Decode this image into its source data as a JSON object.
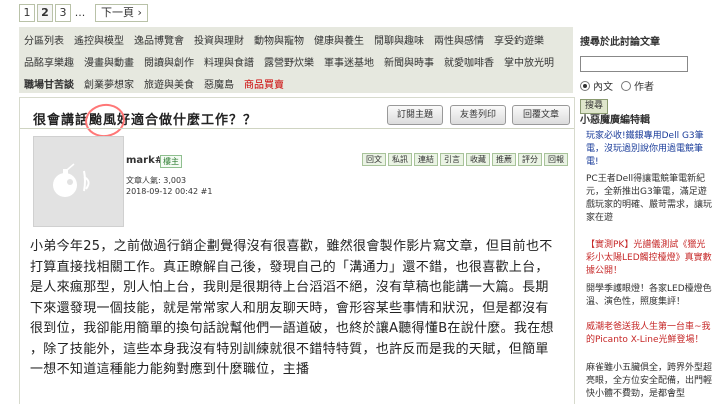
{
  "pager": {
    "pages": [
      "1",
      "2",
      "3"
    ],
    "ellipsis": "...",
    "next": "下一頁 ›"
  },
  "categories": {
    "row1": [
      "分區列表",
      "遙控與模型",
      "逸品博覽會",
      "投資與理財",
      "動物與寵物",
      "健康與養生",
      "閒聊與趣味",
      "兩性與感情",
      "享受釣遊樂"
    ],
    "row2": [
      "品酩享樂趣",
      "漫畫與動畫",
      "閱讀與創作",
      "料理與食譜",
      "露營野炊樂",
      "軍事迷基地",
      "新聞與時事",
      "就愛咖啡香",
      "掌中放光明"
    ],
    "row3": [
      "職場甘苦談",
      "創業夢想家",
      "旅遊與美食",
      "惡魔島"
    ],
    "row3_hot": "商品買賣"
  },
  "thread": {
    "title": "很會講話颱風好適合做什麼工作？？",
    "buttons": [
      "訂閱主題",
      "友善列印",
      "回覆文章"
    ]
  },
  "post": {
    "author": "mark#",
    "level": "樓主",
    "actions": [
      "回文",
      "私訊",
      "連結",
      "引言",
      "收藏",
      "推薦",
      "評分",
      "回報"
    ],
    "count_label": "文章人氣: 3,003",
    "timestamp": "2018-09-12 00:42",
    "floor": "#1",
    "body": "小弟今年25，之前做過行銷企劃覺得沒有很喜歡，雖然很會製作影片寫文章，但目前也不 打算直接找相關工作。真正瞭解自己後，發現自己的「溝通力」還不錯，也很喜歡上台，  是人來瘋那型，別人怕上台，我則是很期待上台滔滔不絕，沒有草稿也能講一大篇。長期 下來還發現一個技能，就是常常家人和朋友聊天時，會形容某些事情和狀況，但是都沒有 很到位，我卻能用簡單的換句話說幫他們一語道破，也終於讓A聽得懂B在說什麼。我在想 ，除了技能外，這些本身我沒有特別訓練就很不錯特特質，也許反而是我的天賦，但簡單 一想不知道這種能力能夠對應到什麼職位，主播"
  },
  "sidebar": {
    "search_title": "搜尋於此討論文章",
    "radio_text": "內文",
    "radio_author": "作者",
    "search_button": "搜尋",
    "section_title": "小惡魔廣編特輯",
    "items": [
      {
        "title": "玩家必收!鐵銀專用Dell G3筆電，沒玩過別說你用過電競筆電!",
        "desc": "PC王者Dell得讓電競筆電新紀元，全新推出G3筆電，滿足遊戲玩家的明確、嚴苛需求，讓玩家在遊"
      },
      {
        "title": "【實測PK】光譜儀測試《獵光彩小太陽LED觸控檯燈》真實數據公開！",
        "desc": "開學季護眼燈！各家LED檯燈色溫、演色性，照度集評！"
      },
      {
        "title": "威潮老爸送我人生第一台車~我的Picanto X-Line光鮮登場！",
        "desc": "麻雀雖小五臟俱全，跨界外型超亮眼，全方位安全配備，出門輕快小體不費勁，是都會型"
      }
    ]
  }
}
